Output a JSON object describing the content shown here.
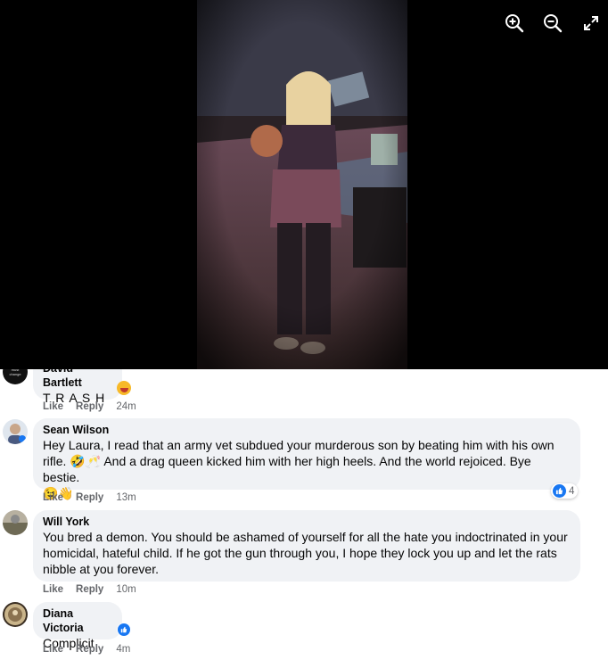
{
  "viewer": {
    "controls": [
      {
        "name": "zoom-in-icon"
      },
      {
        "name": "zoom-out-icon"
      },
      {
        "name": "fullscreen-icon"
      }
    ]
  },
  "comments": [
    {
      "author": "David Bartlett",
      "avatar_text": "must change",
      "lines": [
        "T R A S H"
      ],
      "reaction": "laugh-emoji",
      "like": "Like",
      "reply": "Reply",
      "time": "24m"
    },
    {
      "author": "Sean Wilson",
      "lines": [
        "Hey Laura, I read that an army vet subdued your murderous son by beating him with his own",
        "rifle. 🤣🥂 And a drag queen kicked him with her high heels. And the world rejoiced. Bye bestie.",
        "😉👋"
      ],
      "reaction_count": "4",
      "like": "Like",
      "reply": "Reply",
      "time": "13m"
    },
    {
      "author": "Will York",
      "lines": [
        "You bred a demon. You should be ashamed of yourself for all the hate you indoctrinated in your",
        "homicidal, hateful child. If he got the gun through you, I hope they lock you up and let the rats",
        "nibble at you forever."
      ],
      "like": "Like",
      "reply": "Reply",
      "time": "10m"
    },
    {
      "author": "Diana Victoria",
      "lines": [
        "Complicit"
      ],
      "like": "Like",
      "reply": "Reply",
      "time": "4m"
    }
  ],
  "colors": {
    "viewer_bg": "#000000",
    "bubble_bg": "#f0f2f5",
    "meta_text": "#65676b",
    "like_blue": "#1877f2"
  }
}
